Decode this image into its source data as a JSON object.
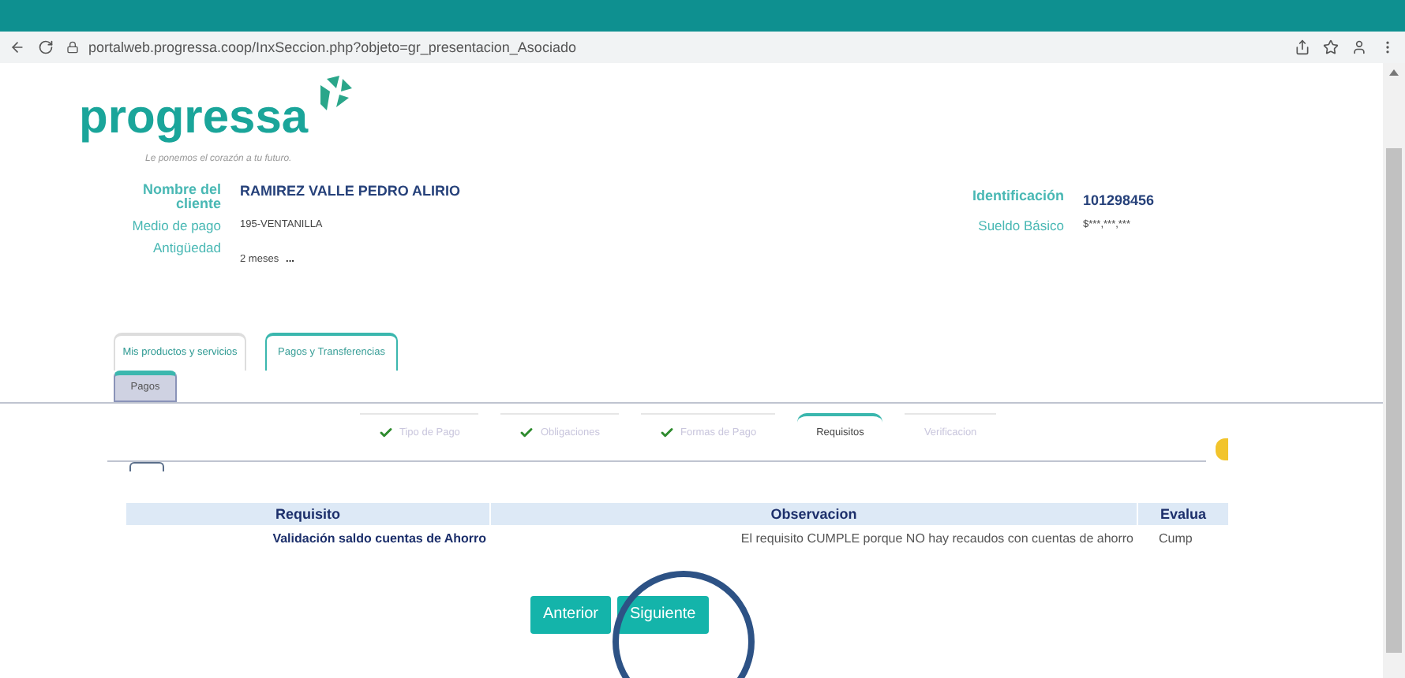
{
  "browser": {
    "url": "portalweb.progressa.coop/InxSeccion.php?objeto=gr_presentacion_Asociado"
  },
  "brand": {
    "name": "progressa",
    "tagline": "Le ponemos el corazón a tu futuro."
  },
  "client": {
    "name_label": "Nombre del cliente",
    "name": "RAMIREZ VALLE PEDRO ALIRIO",
    "id_label": "Identificación",
    "id": "101298456",
    "payment_label": "Medio de pago",
    "payment": "195-VENTANILLA",
    "salary_label": "Sueldo Básico",
    "salary": "$***,***,***",
    "age_label": "Antigüedad",
    "age": "2 meses",
    "more": "..."
  },
  "tabs": [
    {
      "label": "Mis productos y servicios",
      "selected": false
    },
    {
      "label": "Pagos y Transferencias",
      "selected": true
    }
  ],
  "subtabs": [
    {
      "label": "Pagos",
      "selected": true
    }
  ],
  "steps": [
    {
      "label": "Tipo de Pago",
      "done": true,
      "selected": false
    },
    {
      "label": "Obligaciones",
      "done": true,
      "selected": false
    },
    {
      "label": "Formas de Pago",
      "done": true,
      "selected": false
    },
    {
      "label": "Requisitos",
      "done": false,
      "selected": true
    },
    {
      "label": "Verificacion",
      "done": false,
      "selected": false
    }
  ],
  "table": {
    "columns": [
      "Requisito",
      "Observacion",
      "Evalua"
    ],
    "rows": [
      [
        "Validación saldo cuentas de Ahorro",
        "El requisito CUMPLE porque NO hay recaudos con cuentas de ahorro",
        "Cump"
      ]
    ]
  },
  "buttons": [
    "Anterior",
    "Siguiente"
  ]
}
